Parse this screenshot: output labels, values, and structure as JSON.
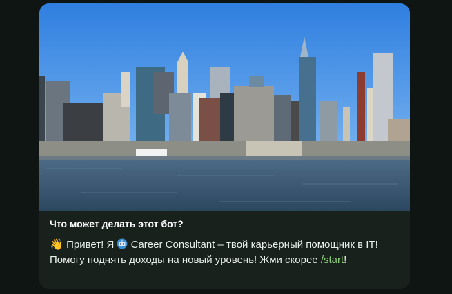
{
  "card": {
    "title": "Что может делать этот бот?",
    "message": {
      "wave": "👋",
      "part1": " Привет! Я ",
      "part2": " Career Consultant – твой карьерный помощник в IT! Помогу поднять доходы на новый уровень! Жми скорее ",
      "command": "/start",
      "end": "!"
    },
    "image_icon": "city-skyline-photo",
    "robot_icon": "robot-emoji-icon"
  },
  "colors": {
    "background": "#0e1512",
    "card": "#18211c",
    "command": "#8fd17a"
  }
}
